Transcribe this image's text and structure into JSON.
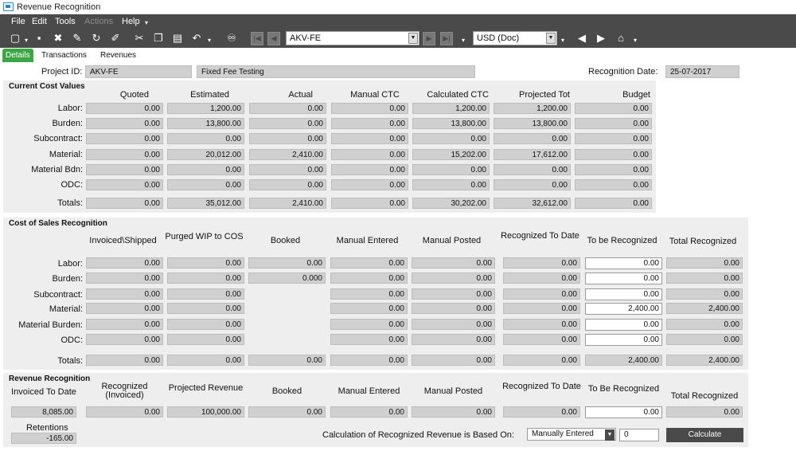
{
  "window": {
    "title": "Revenue Recognition"
  },
  "menu": {
    "file": "File",
    "edit": "Edit",
    "tools": "Tools",
    "actions": "Actions",
    "help": "Help"
  },
  "toolbar": {
    "record": "AKV-FE",
    "currency": "USD (Doc)"
  },
  "tabs": {
    "details": "Details",
    "transactions": "Transactions",
    "revenues": "Revenues"
  },
  "header": {
    "project_label": "Project ID:",
    "project_id": "AKV-FE",
    "project_desc": "Fixed Fee Testing",
    "date_label": "Recognition Date:",
    "date": "25-07-2017"
  },
  "cost_values": {
    "title": "Current Cost Values",
    "columns": [
      "Quoted",
      "Estimated",
      "Actual",
      "Manual CTC",
      "Calculated CTC",
      "Projected Tot",
      "Budget"
    ],
    "rows": [
      {
        "label": "Labor:",
        "v": [
          "0.00",
          "1,200.00",
          "0.00",
          "0.00",
          "1,200.00",
          "1,200.00",
          "0.00"
        ]
      },
      {
        "label": "Burden:",
        "v": [
          "0.00",
          "13,800.00",
          "0.00",
          "0.00",
          "13,800.00",
          "13,800.00",
          "0.00"
        ]
      },
      {
        "label": "Subcontract:",
        "v": [
          "0.00",
          "0.00",
          "0.00",
          "0.00",
          "0.00",
          "0.00",
          "0.00"
        ]
      },
      {
        "label": "Material:",
        "v": [
          "0.00",
          "20,012.00",
          "2,410.00",
          "0.00",
          "15,202.00",
          "17,612.00",
          "0.00"
        ]
      },
      {
        "label": "Material Bdn:",
        "v": [
          "0.00",
          "0.00",
          "0.00",
          "0.00",
          "0.00",
          "0.00",
          "0.00"
        ]
      },
      {
        "label": "ODC:",
        "v": [
          "0.00",
          "0.00",
          "0.00",
          "0.00",
          "0.00",
          "0.00",
          "0.00"
        ]
      }
    ],
    "totals": {
      "label": "Totals:",
      "v": [
        "0.00",
        "35,012.00",
        "2,410.00",
        "0.00",
        "30,202.00",
        "32,612.00",
        "0.00"
      ]
    }
  },
  "cost_of_sales": {
    "title": "Cost of Sales Recognition",
    "columns": [
      "Invoiced\\Shipped",
      "Purged WIP to COS",
      "Booked",
      "Manual Entered",
      "Manual Posted",
      "Recognized To Date",
      "To be Recognized",
      "Total Recognized"
    ],
    "rows": [
      {
        "label": "Labor:",
        "v": [
          "0.00",
          "0.00",
          "0.00",
          "0.00",
          "0.00",
          "0.00",
          "0.00",
          "0.00"
        ]
      },
      {
        "label": "Burden:",
        "v": [
          "0.00",
          "0.00",
          "0.000",
          "0.00",
          "0.00",
          "0.00",
          "0.00",
          "0.00"
        ]
      },
      {
        "label": "Subcontract:",
        "v": [
          "0.00",
          "0.00",
          "",
          "0.00",
          "0.00",
          "0.00",
          "0.00",
          "0.00"
        ]
      },
      {
        "label": "Material:",
        "v": [
          "0.00",
          "0.00",
          "",
          "0.00",
          "0.00",
          "0.00",
          "2,400.00",
          "2,400.00"
        ]
      },
      {
        "label": "Material Burden:",
        "v": [
          "0.00",
          "0.00",
          "",
          "0.00",
          "0.00",
          "0.00",
          "0.00",
          "0.00"
        ]
      },
      {
        "label": "ODC:",
        "v": [
          "0.00",
          "0.00",
          "",
          "0.00",
          "0.00",
          "0.00",
          "0.00",
          "0.00"
        ]
      }
    ],
    "totals": {
      "label": "Totals:",
      "v": [
        "0.00",
        "0.00",
        "0.00",
        "0.00",
        "0.00",
        "0.00",
        "2,400.00",
        "2,400.00"
      ]
    }
  },
  "revenue": {
    "title": "Revenue Recognition",
    "columns": [
      "Invoiced To Date",
      "Recognized (Invoiced)",
      "Projected Revenue",
      "Booked",
      "Manual Entered",
      "Manual Posted",
      "Recognized To Date",
      "To Be Recognized",
      "Total Recognized"
    ],
    "values": [
      "8,085.00",
      "0.00",
      "100,000.00",
      "0.00",
      "0.00",
      "0.00",
      "0.00",
      "0.00",
      "0.00"
    ],
    "retentions_label": "Retentions",
    "retentions": "-165.00",
    "basis_label": "Calculation of Recognized Revenue is Based On:",
    "basis": "Manually Entered",
    "basis_value": "0",
    "calculate": "Calculate"
  }
}
